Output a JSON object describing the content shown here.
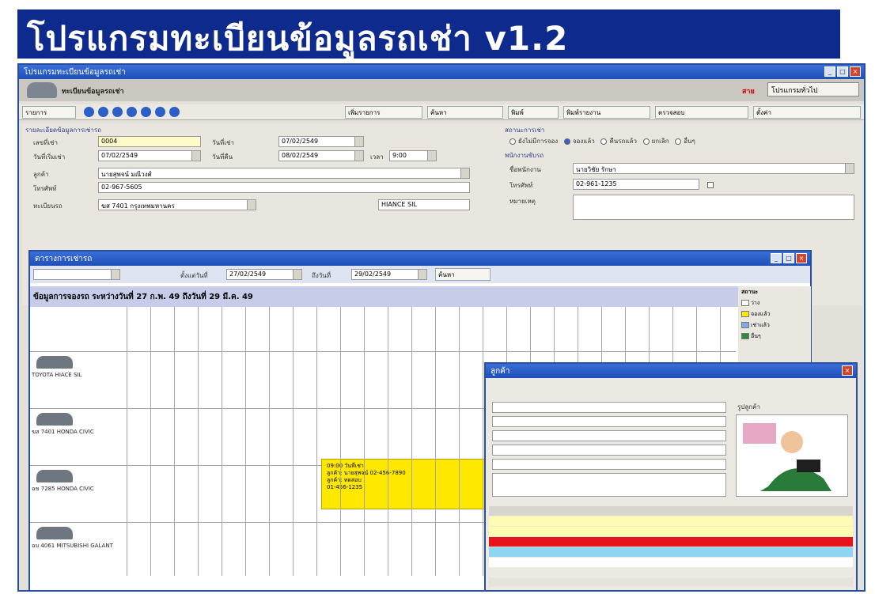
{
  "banner": {
    "title": "โปรแกรมทะเบียนข้อมูลรถเช่า v1.2"
  },
  "main_window": {
    "title": "โปรแกรมทะเบียนข้อมูลรถเช่า",
    "header_subtitle": "ทะเบียนข้อมูลรถเช่า",
    "header_red": "สาย",
    "header_right_button": "โปรแกรมทั่วไป",
    "toolbar": {
      "items": [
        "รายการ",
        "เพิ่มรายการ",
        "ค้นหา",
        "พิมพ์",
        "พิมพ์รายงาน",
        "ตรวจสอบ",
        "ตั้งค่า"
      ]
    },
    "form": {
      "group_title": "รายละเอียดข้อมูลการเช่ารถ",
      "rent_no_label": "เลขที่เช่า",
      "rent_no": "0004",
      "rent_date_label": "วันที่เช่า",
      "rent_date": "07/02/2549",
      "start_date_label": "วันที่เริ่มเช่า",
      "start_date": "07/02/2549",
      "return_date_label": "วันที่คืน",
      "return_date": "08/02/2549",
      "time_label": "เวลา",
      "time": "9:00",
      "customer_label": "ลูกค้า",
      "customer_name": "นายสุพจน์ มณีวงศ์",
      "phone_label": "โทรศัพท์",
      "phone": "02-967-5605",
      "plate_label": "ทะเบียนรถ",
      "plate": "ฆส 7401 กรุงเทพมหานคร",
      "model": "HIANCE SIL",
      "status_group": "สถานะการเช่า",
      "status_options": [
        "ยังไม่มีการจอง",
        "จองแล้ว",
        "คืนรถแล้ว",
        "ยกเลิก",
        "อื่นๆ"
      ],
      "driver_group": "พนักงานขับรถ",
      "driver_label": "ชื่อพนักงาน",
      "driver_name": "นายวิชัย รักษา",
      "driver_phone_label": "โทรศัพท์",
      "driver_phone": "02-961-1235",
      "note_label": "หมายเหตุ"
    }
  },
  "schedule_window": {
    "title": "ตารางการเช่ารถ",
    "filter_from_label": "ตั้งแต่วันที่",
    "filter_from": "27/02/2549",
    "filter_to_label": "ถึงวันที่",
    "filter_to": "29/02/2549",
    "filter_button": "ค้นหา",
    "heading": "ข้อมูลการจองรถ ระหว่างวันที่ 27 ก.พ. 49 ถึงวันที่ 29 มี.ค. 49",
    "cars": [
      {
        "label": "TOYOTA HIACE SIL"
      },
      {
        "label": "ฆส 7401 HONDA CIVIC"
      },
      {
        "label": "ฉข 7285 HONDA CIVIC"
      },
      {
        "label": "ฉบ 4061 MITSUBISHI GALANT"
      }
    ],
    "booking": {
      "line1": "09:00 วันที่เช่า",
      "line2": "ลูกค้า: นายสุพจน์ 02-456-7890",
      "line3": "ลูกค้า: ทดสอบ",
      "line4": "01-456-1235"
    },
    "legend": {
      "title": "สถานะ",
      "items": [
        {
          "label": "ว่าง",
          "color": "#ffffff"
        },
        {
          "label": "จองแล้ว",
          "color": "#ffe800"
        },
        {
          "label": "เช่าแล้ว",
          "color": "#86a7e6"
        },
        {
          "label": "อื่นๆ",
          "color": "#2e8b3a"
        }
      ]
    }
  },
  "customer_window": {
    "title": "ลูกค้า",
    "photo_label": "รูปลูกค้า"
  }
}
